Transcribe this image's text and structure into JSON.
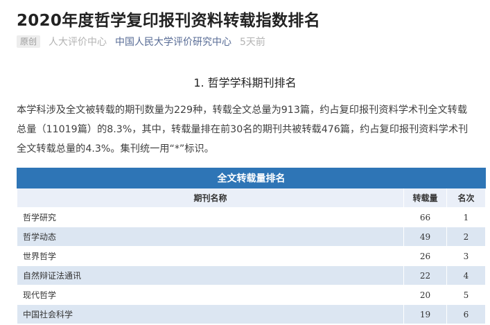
{
  "article": {
    "title": "2020年度哲学复印报刊资料转载指数排名",
    "badge": "原创",
    "source": "人大评价中心",
    "account": "中国人民大学评价研究中心",
    "time": "5天前"
  },
  "section": {
    "heading": "1. 哲学学科期刊排名",
    "paragraph": "本学科涉及全文被转载的期刊数量为229种，转载全文总量为913篇，约占复印报刊资料学术刊全文转载总量（11019篇）的8.3%，其中，转载量排在前30名的期刊共被转载476篇，约占复印报刊资料学术刊全文转载总量的4.3%。集刊统一用“*”标识。"
  },
  "table": {
    "caption": "全文转载量排名",
    "headers": {
      "name": "期刊名称",
      "count": "转载量",
      "rank": "名次"
    },
    "rows": [
      {
        "name": "哲学研究",
        "count": "66",
        "rank": "1"
      },
      {
        "name": "哲学动态",
        "count": "49",
        "rank": "2"
      },
      {
        "name": "世界哲学",
        "count": "26",
        "rank": "3"
      },
      {
        "name": "自然辩证法通讯",
        "count": "22",
        "rank": "4"
      },
      {
        "name": "现代哲学",
        "count": "20",
        "rank": "5"
      },
      {
        "name": "中国社会科学",
        "count": "19",
        "rank": "6"
      }
    ]
  }
}
